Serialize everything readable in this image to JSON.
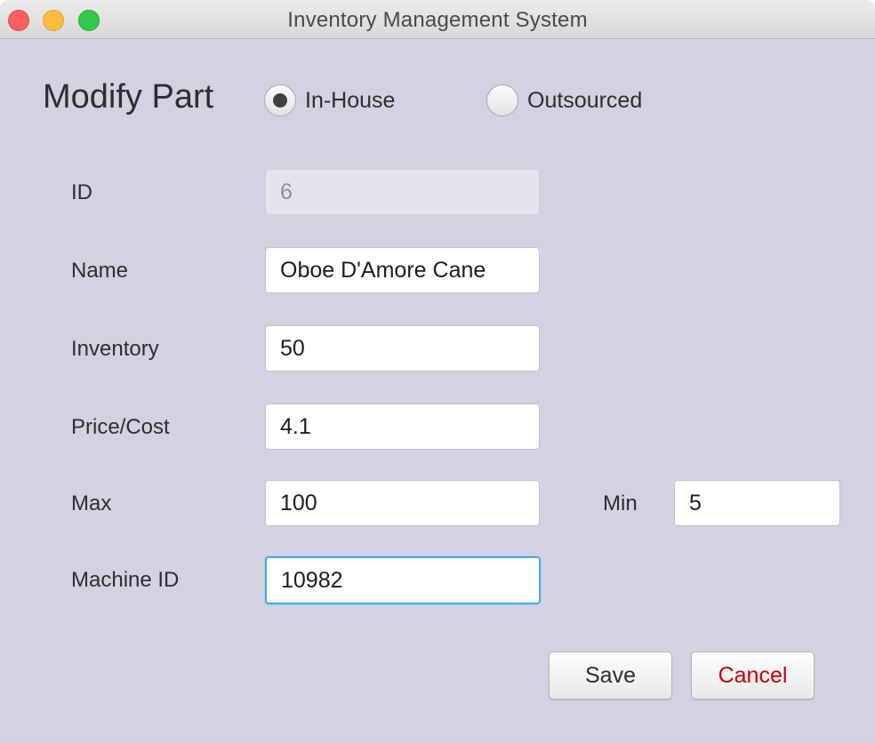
{
  "window": {
    "title": "Inventory Management System"
  },
  "header": {
    "title": "Modify Part",
    "source_options": [
      {
        "label": "In-House",
        "selected": true
      },
      {
        "label": "Outsourced",
        "selected": false
      }
    ]
  },
  "form": {
    "id": {
      "label": "ID",
      "value": "6",
      "disabled": true
    },
    "name": {
      "label": "Name",
      "value": "Oboe D'Amore Cane"
    },
    "inventory": {
      "label": "Inventory",
      "value": "50"
    },
    "price": {
      "label": "Price/Cost",
      "value": "4.1"
    },
    "max": {
      "label": "Max",
      "value": "100"
    },
    "min": {
      "label": "Min",
      "value": "5"
    },
    "machine_id": {
      "label": "Machine ID",
      "value": "10982",
      "focused": true
    }
  },
  "buttons": {
    "save": "Save",
    "cancel": "Cancel"
  },
  "colors": {
    "background": "#d5d0e4",
    "cancel_text": "#cc0000",
    "focus_ring": "#4aa8e8"
  }
}
